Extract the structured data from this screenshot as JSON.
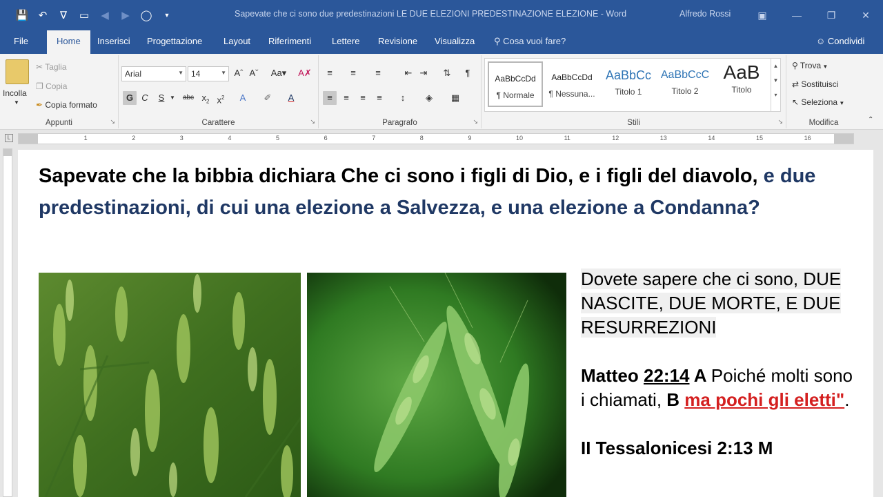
{
  "titlebar": {
    "doc_title": "Sapevate che ci sono due predestinazioni LE DUE ELEZIONI PREDESTINAZIONE ELEZIONE  -  Word",
    "user": "Alfredo Rossi"
  },
  "tabs": {
    "file": "File",
    "home": "Home",
    "insert": "Inserisci",
    "design": "Progettazione",
    "layout": "Layout",
    "references": "Riferimenti",
    "mailings": "Lettere",
    "review": "Revisione",
    "view": "Visualizza",
    "tell_me": "Cosa vuoi fare?",
    "share": "Condividi"
  },
  "ribbon": {
    "clipboard": {
      "paste": "Incolla",
      "cut": "Taglia",
      "copy": "Copia",
      "format_painter": "Copia formato",
      "label": "Appunti"
    },
    "font": {
      "name": "Arial",
      "size": "14",
      "label": "Carattere"
    },
    "paragraph": {
      "label": "Paragrafo"
    },
    "styles": {
      "items": [
        {
          "preview": "AaBbCcDd",
          "name": "¶ Normale"
        },
        {
          "preview": "AaBbCcDd",
          "name": "¶ Nessuna..."
        },
        {
          "preview": "AaBbCc",
          "name": "Titolo 1"
        },
        {
          "preview": "AaBbCcC",
          "name": "Titolo 2"
        },
        {
          "preview": "AaB",
          "name": "Titolo"
        }
      ],
      "label": "Stili"
    },
    "editing": {
      "find": "Trova",
      "replace": "Sostituisci",
      "select": "Seleziona",
      "label": "Modifica"
    }
  },
  "ruler": {
    "numbers": [
      "1",
      "2",
      "3",
      "4",
      "5",
      "6",
      "7",
      "8",
      "9",
      "10",
      "11",
      "12",
      "13",
      "14",
      "15",
      "16"
    ]
  },
  "document": {
    "heading_black": "Sapevate che la bibbia dichiara Che ci sono i figli di Dio, e i figli del diavolo, ",
    "heading_blue": "e due predestinazioni, di cui una elezione a Salvezza, e una elezione a Condanna?",
    "side_para1": "Dovete sapere che ci sono, DUE NASCITE, DUE MORTE, E DUE RESURREZIONI",
    "verse_book": "Matteo ",
    "verse_ref": "22:14",
    "verse_a": "  A ",
    "verse_text": "Poiché molti sono i chiamati, ",
    "verse_b": "B ",
    "verse_red": "ma pochi gli eletti\"",
    "verse_end": ".",
    "next_line": "II Tessalonicesi 2:13   M"
  },
  "colors": {
    "word_blue": "#2b579a",
    "heading_blue": "#1f3864",
    "verse_red": "#d42020"
  },
  "images": [
    {
      "name": "wheat-field-photo",
      "subject": "green wheat field"
    },
    {
      "name": "wheat-ears-photo",
      "subject": "close-up green wheat ears"
    }
  ]
}
